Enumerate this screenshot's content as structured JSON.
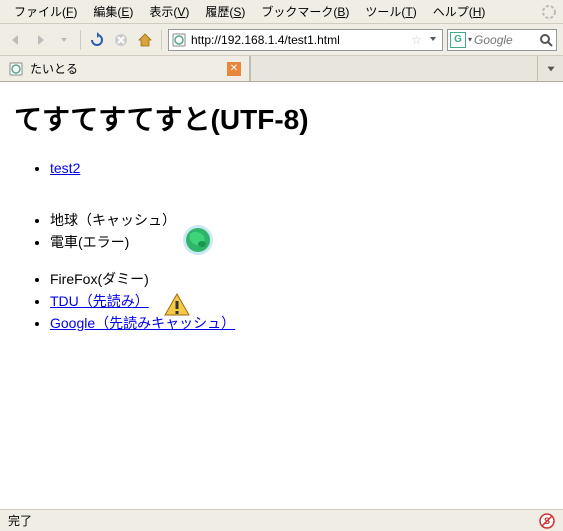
{
  "menu": {
    "file": "ファイル(",
    "file_u": "F",
    "file_e": ")",
    "edit": "編集(",
    "edit_u": "E",
    "edit_e": ")",
    "view": "表示(",
    "view_u": "V",
    "view_e": ")",
    "history": "履歴(",
    "history_u": "S",
    "history_e": ")",
    "bookmarks": "ブックマーク(",
    "bookmarks_u": "B",
    "bookmarks_e": ")",
    "tools": "ツール(",
    "tools_u": "T",
    "tools_e": ")",
    "help": "ヘルプ(",
    "help_u": "H",
    "help_e": ")"
  },
  "url": "http://192.168.1.4/test1.html",
  "search": {
    "placeholder": "Google",
    "engine": "G"
  },
  "tab": {
    "title": "たいとる"
  },
  "page": {
    "heading": "てすてすてすと(UTF-8)",
    "items": [
      {
        "text": "test2",
        "link": true
      },
      {
        "text": "地球（キャッシュ）",
        "link": false
      },
      {
        "text": "電車(エラー)",
        "link": false
      },
      {
        "text": "FireFox(ダミー)",
        "link": false
      },
      {
        "text": "TDU（先読み）",
        "link": true
      },
      {
        "text": "Google（先読みキャッシュ）",
        "link": true
      }
    ]
  },
  "status": "完了"
}
